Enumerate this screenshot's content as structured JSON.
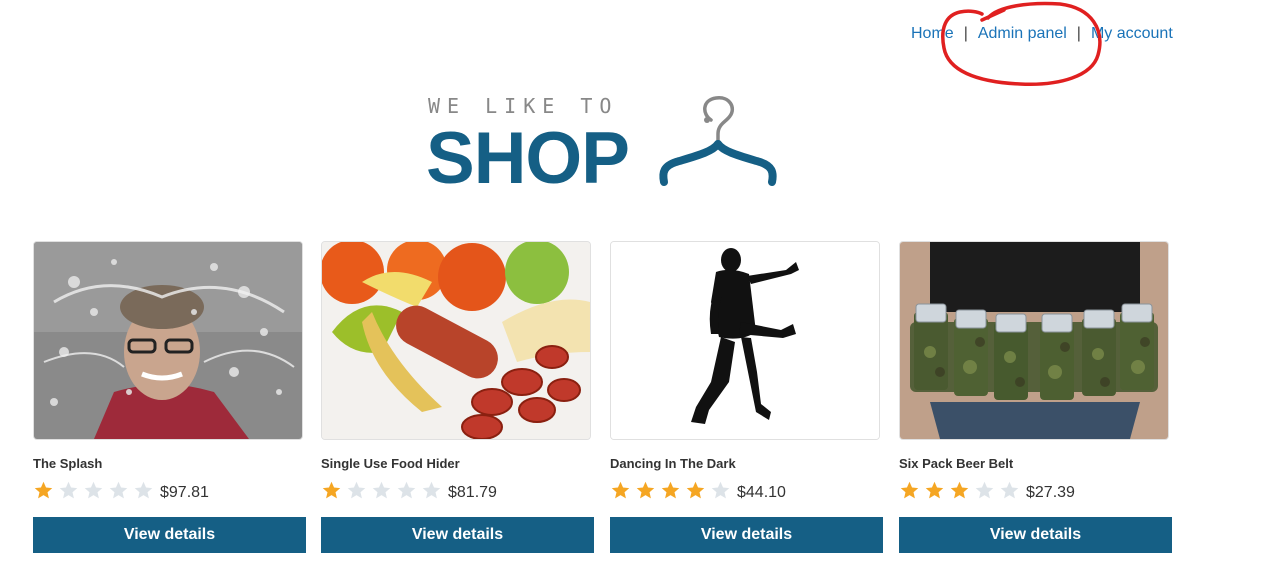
{
  "nav": {
    "home": "Home",
    "separator": "|",
    "admin_panel": "Admin panel",
    "my_account": "My account"
  },
  "logo": {
    "top_text": "WE LIKE TO",
    "main_text": "SHOP"
  },
  "colors": {
    "brand": "#155f85",
    "link": "#1a73b8",
    "star_filled": "#f5a623",
    "star_empty": "#dde3e8",
    "annotation": "#e02020"
  },
  "products": [
    {
      "name": "The Splash",
      "rating": 1,
      "max_rating": 5,
      "price": "$97.81",
      "button": "View details",
      "image": "splash-photo"
    },
    {
      "name": "Single Use Food Hider",
      "rating": 1,
      "max_rating": 5,
      "price": "$81.79",
      "button": "View details",
      "image": "banana-sausage-photo"
    },
    {
      "name": "Dancing In The Dark",
      "rating": 4,
      "max_rating": 5,
      "price": "$44.10",
      "button": "View details",
      "image": "dancer-silhouette"
    },
    {
      "name": "Six Pack Beer Belt",
      "rating": 3,
      "max_rating": 5,
      "price": "$27.39",
      "button": "View details",
      "image": "beer-belt-photo"
    }
  ]
}
